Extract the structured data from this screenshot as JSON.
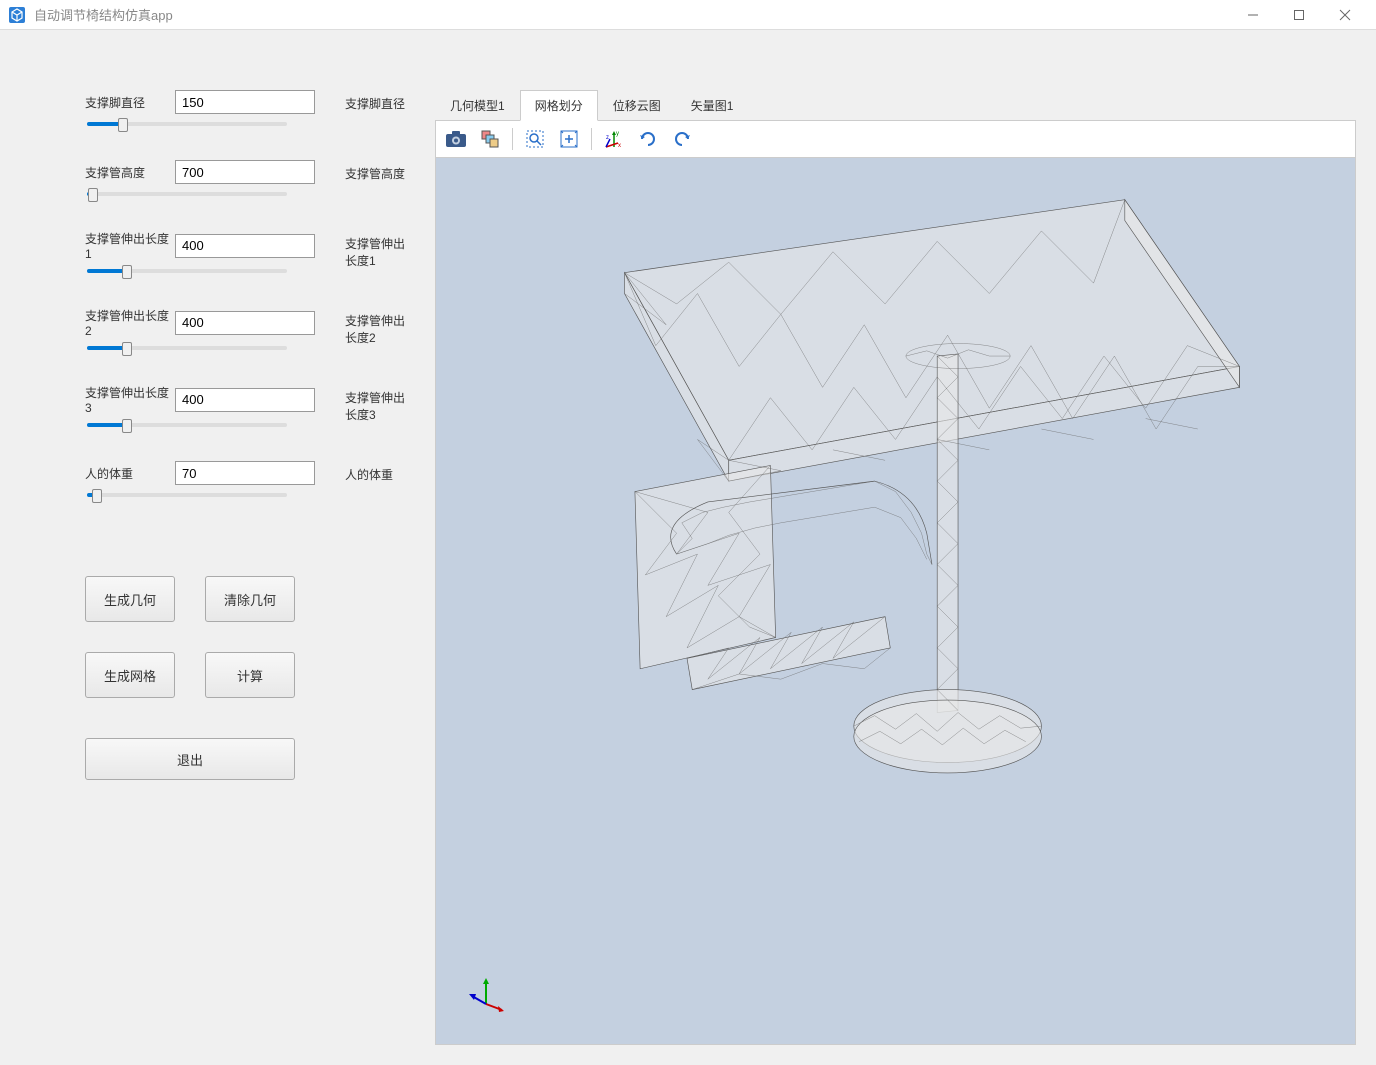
{
  "window": {
    "title": "自动调节椅结构仿真app"
  },
  "params": [
    {
      "label": "支撑脚直径",
      "value": "150",
      "rightLabel": "支撑脚直径",
      "sliderPercent": 18
    },
    {
      "label": "支撑管高度",
      "value": "700",
      "rightLabel": "支撑管高度",
      "sliderPercent": 3
    },
    {
      "label": "支撑管伸出长度1",
      "value": "400",
      "rightLabel": "支撑管伸出长度1",
      "sliderPercent": 20
    },
    {
      "label": "支撑管伸出长度2",
      "value": "400",
      "rightLabel": "支撑管伸出长度2",
      "sliderPercent": 20
    },
    {
      "label": "支撑管伸出长度3",
      "value": "400",
      "rightLabel": "支撑管伸出长度3",
      "sliderPercent": 20
    },
    {
      "label": "人的体重",
      "value": "70",
      "rightLabel": "人的体重",
      "sliderPercent": 5
    }
  ],
  "buttons": {
    "genGeometry": "生成几何",
    "clearGeometry": "清除几何",
    "genMesh": "生成网格",
    "compute": "计算",
    "exit": "退出"
  },
  "tabs": [
    {
      "label": "几何模型1",
      "active": false
    },
    {
      "label": "网格划分",
      "active": true
    },
    {
      "label": "位移云图",
      "active": false
    },
    {
      "label": "矢量图1",
      "active": false
    }
  ]
}
